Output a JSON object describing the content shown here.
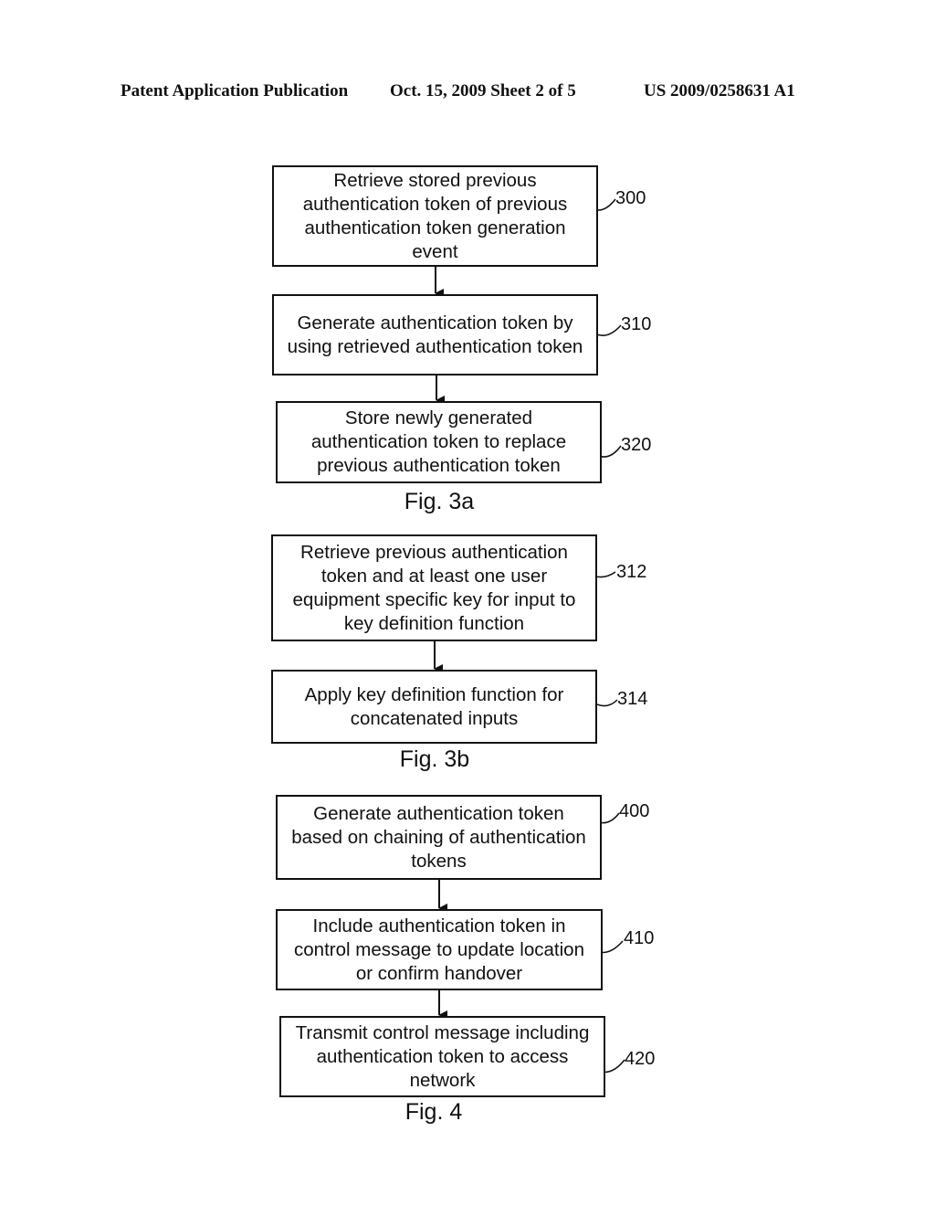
{
  "header": {
    "publication": "Patent Application Publication",
    "date_sheet": "Oct. 15, 2009   Sheet 2 of 5",
    "number": "US 2009/0258631 A1"
  },
  "figures": [
    {
      "label": "Fig. 3a",
      "steps": [
        {
          "ref": "300",
          "text": "Retrieve stored previous\nauthentication token of previous\nauthentication token generation\nevent"
        },
        {
          "ref": "310",
          "text": "Generate authentication token by\nusing retrieved authentication token"
        },
        {
          "ref": "320",
          "text": "Store newly generated\nauthentication token to replace\nprevious authentication token"
        }
      ]
    },
    {
      "label": "Fig. 3b",
      "steps": [
        {
          "ref": "312",
          "text": "Retrieve previous authentication\ntoken and at least one user\nequipment specific key for input to\nkey definition function"
        },
        {
          "ref": "314",
          "text": "Apply key definition function for\nconcatenated inputs"
        }
      ]
    },
    {
      "label": "Fig. 4",
      "steps": [
        {
          "ref": "400",
          "text": "Generate authentication token\nbased on chaining of authentication\ntokens"
        },
        {
          "ref": "410",
          "text": "Include authentication token in\ncontrol message to update location\nor confirm handover"
        },
        {
          "ref": "420",
          "text": "Transmit control message including\nauthentication token to access\nnetwork"
        }
      ]
    }
  ]
}
